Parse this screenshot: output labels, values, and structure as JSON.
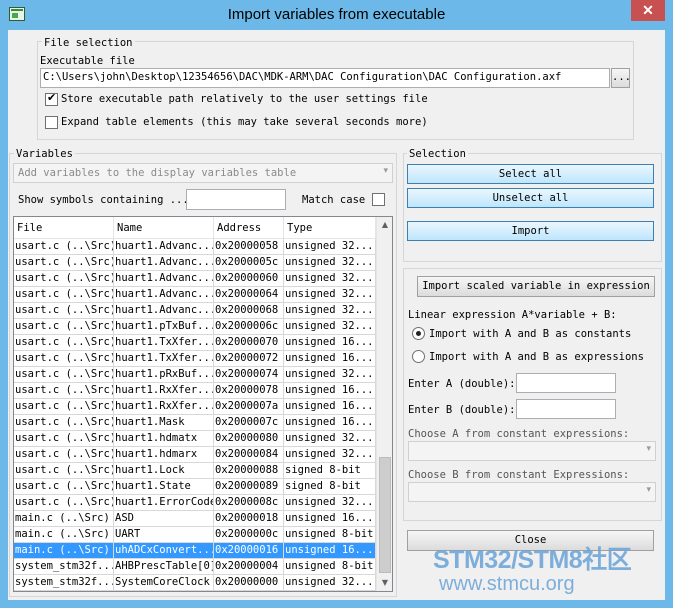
{
  "window": {
    "title": "Import variables from executable",
    "close_glyph": "✕"
  },
  "file_selection": {
    "group_title": "File selection",
    "executable_label": "Executable file",
    "executable_path": "C:\\Users\\john\\Desktop\\12354656\\DAC\\MDK-ARM\\DAC Configuration\\DAC Configuration.axf",
    "browse_label": "...",
    "store_relative_label": "Store executable path relatively to the user settings file",
    "store_relative_checked": true,
    "expand_table_label": "Expand table elements (this may take several seconds more)",
    "expand_table_checked": false
  },
  "variables": {
    "group_title": "Variables",
    "add_combo_text": "Add variables to the display variables table",
    "show_symbols_label": "Show symbols containing ...",
    "search_value": "",
    "match_case_label": "Match case",
    "match_case_checked": false,
    "columns": [
      "File",
      "Name",
      "Address",
      "Type"
    ],
    "rows": [
      [
        "usart.c (..\\Src)",
        "huart1.Advanc...",
        "0x20000058",
        "unsigned 32..."
      ],
      [
        "usart.c (..\\Src)",
        "huart1.Advanc...",
        "0x2000005c",
        "unsigned 32..."
      ],
      [
        "usart.c (..\\Src)",
        "huart1.Advanc...",
        "0x20000060",
        "unsigned 32..."
      ],
      [
        "usart.c (..\\Src)",
        "huart1.Advanc...",
        "0x20000064",
        "unsigned 32..."
      ],
      [
        "usart.c (..\\Src)",
        "huart1.Advanc...",
        "0x20000068",
        "unsigned 32..."
      ],
      [
        "usart.c (..\\Src)",
        "huart1.pTxBuf...",
        "0x2000006c",
        "unsigned 32..."
      ],
      [
        "usart.c (..\\Src)",
        "huart1.TxXfer...",
        "0x20000070",
        "unsigned 16..."
      ],
      [
        "usart.c (..\\Src)",
        "huart1.TxXfer...",
        "0x20000072",
        "unsigned 16..."
      ],
      [
        "usart.c (..\\Src)",
        "huart1.pRxBuf...",
        "0x20000074",
        "unsigned 32..."
      ],
      [
        "usart.c (..\\Src)",
        "huart1.RxXfer...",
        "0x20000078",
        "unsigned 16..."
      ],
      [
        "usart.c (..\\Src)",
        "huart1.RxXfer...",
        "0x2000007a",
        "unsigned 16..."
      ],
      [
        "usart.c (..\\Src)",
        "huart1.Mask",
        "0x2000007c",
        "unsigned 16..."
      ],
      [
        "usart.c (..\\Src)",
        "huart1.hdmatx",
        "0x20000080",
        "unsigned 32..."
      ],
      [
        "usart.c (..\\Src)",
        "huart1.hdmarx",
        "0x20000084",
        "unsigned 32..."
      ],
      [
        "usart.c (..\\Src)",
        "huart1.Lock",
        "0x20000088",
        "signed 8-bit"
      ],
      [
        "usart.c (..\\Src)",
        "huart1.State",
        "0x20000089",
        "signed 8-bit"
      ],
      [
        "usart.c (..\\Src)",
        "huart1.ErrorCode",
        "0x2000008c",
        "unsigned 32..."
      ],
      [
        "main.c (..\\Src)",
        "ASD",
        "0x20000018",
        "unsigned 16..."
      ],
      [
        "main.c (..\\Src)",
        "UART",
        "0x2000000c",
        "unsigned 8-bit"
      ],
      [
        "main.c (..\\Src)",
        "uhADCxConvert...",
        "0x20000016",
        "unsigned 16..."
      ],
      [
        "system_stm32f...",
        "AHBPrescTable[0]",
        "0x20000004",
        "unsigned 8-bit"
      ],
      [
        "system_stm32f...",
        "SystemCoreClock",
        "0x20000000",
        "unsigned 32..."
      ]
    ],
    "selected_row": 19,
    "scroll_up_glyph": "▲",
    "scroll_down_glyph": "▼"
  },
  "selection": {
    "group_title": "Selection",
    "select_all_label": "Select all",
    "unselect_all_label": "Unselect all",
    "import_label": "Import",
    "import_scaled_label": "Import scaled variable in expression",
    "linear_expr_label": "Linear expression A*variable + B:",
    "radio_constants_label": "Import with A and B as constants",
    "radio_constants_checked": true,
    "radio_expressions_label": "Import with A and B as expressions",
    "radio_expressions_checked": false,
    "enter_a_label": "Enter A (double):",
    "enter_a_value": "",
    "enter_b_label": "Enter B (double):",
    "enter_b_value": "",
    "choose_a_label": "Choose A from constant expressions:",
    "choose_a_value": "",
    "choose_b_label": "Choose B from constant Expressions:",
    "choose_b_value": "",
    "dropdown_glyph": "▾",
    "close_label": "Close"
  },
  "watermark": {
    "line1": "STM32/STM8社区",
    "line2": "www.stmcu.org"
  }
}
